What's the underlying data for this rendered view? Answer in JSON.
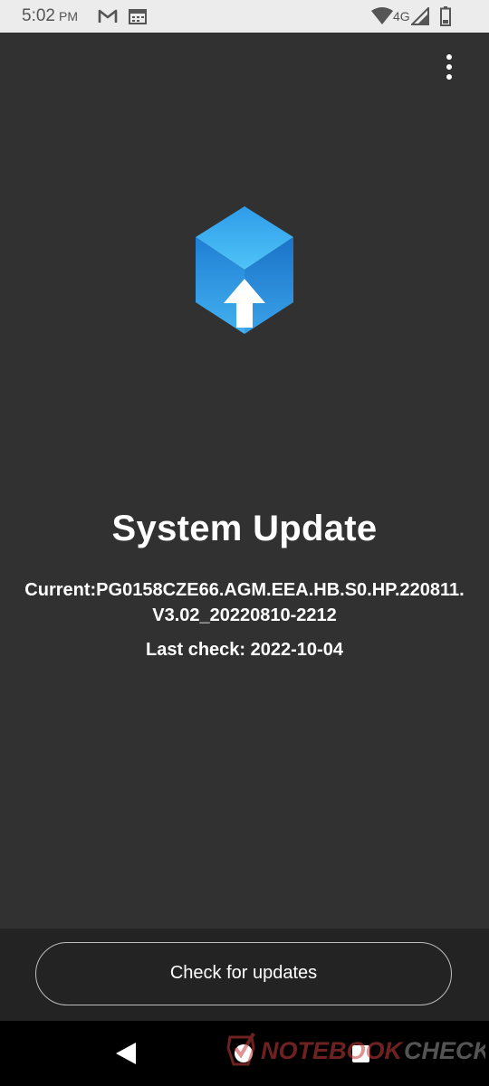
{
  "status_bar": {
    "time": "5:02",
    "ampm": "PM",
    "network": "4G",
    "icons": [
      "gmail-icon",
      "calendar-icon",
      "wifi-icon",
      "signal-icon",
      "battery-icon"
    ]
  },
  "app": {
    "title": "System Update",
    "current_version_line1": "Current:PG0158CZE66.AGM.EEA.HB.S0.HP.220811.",
    "current_version_line2": "V3.02_20220810-2212",
    "last_check": "Last check: 2022-10-04",
    "menu_icon": "more-vertical-icon",
    "logo_icon": "update-cube-icon"
  },
  "actions": {
    "check_button_label": "Check for updates"
  },
  "navigation": {
    "icons": [
      "back-icon",
      "home-icon",
      "recents-icon"
    ]
  },
  "watermark": {
    "text": "NOTEBOOKCHECK"
  },
  "colors": {
    "background": "#313131",
    "bottom_bar": "#232323",
    "status_bar": "#ececec",
    "accent_blue": "#2c9be8"
  }
}
